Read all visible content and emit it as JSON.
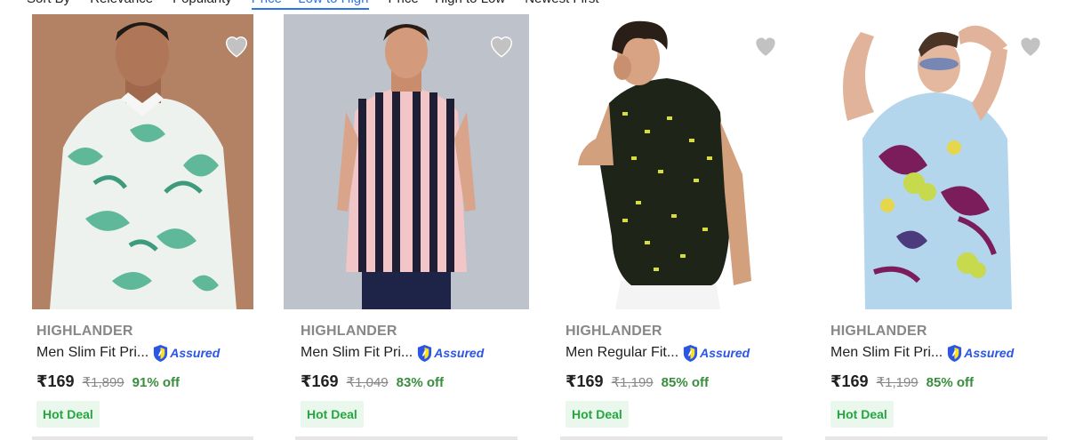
{
  "sort": {
    "label": "Sort By",
    "options": [
      "Relevance",
      "Popularity",
      "Price -- Low to High",
      "Price -- High to Low",
      "Newest First"
    ]
  },
  "products": [
    {
      "brand": "HIGHLANDER",
      "title": "Men Slim Fit Pri...",
      "assured": "Assured",
      "price": "₹169",
      "mrp": "₹1,899",
      "off": "91% off",
      "deal": "Hot Deal"
    },
    {
      "brand": "HIGHLANDER",
      "title": "Men Slim Fit Pri...",
      "assured": "Assured",
      "price": "₹169",
      "mrp": "₹1,049",
      "off": "83% off",
      "deal": "Hot Deal"
    },
    {
      "brand": "HIGHLANDER",
      "title": "Men Regular Fit...",
      "assured": "Assured",
      "price": "₹169",
      "mrp": "₹1,199",
      "off": "85% off",
      "deal": "Hot Deal"
    },
    {
      "brand": "HIGHLANDER",
      "title": "Men Slim Fit Pri...",
      "assured": "Assured",
      "price": "₹169",
      "mrp": "₹1,199",
      "off": "85% off",
      "deal": "Hot Deal"
    }
  ],
  "colors": {
    "accent": "#2874f0",
    "discount": "#388e3c",
    "deal_bg": "#e9f7ec",
    "deal_text": "#26a541"
  }
}
